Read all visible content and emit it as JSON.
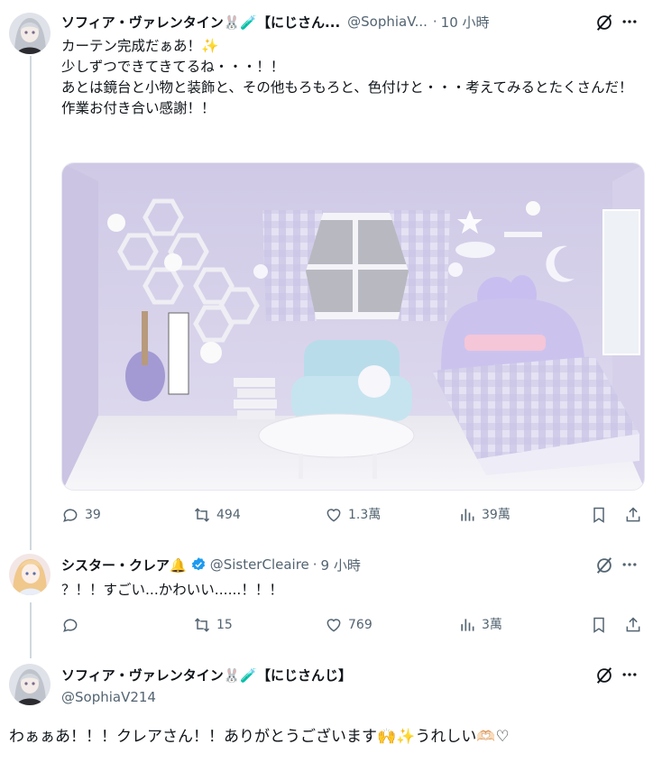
{
  "tweet1": {
    "display_name": "ソフィア・ヴァレンタイン🐰🧪【にじさん...",
    "handle": "@SophiaV...",
    "separator": "·",
    "time": "10 小時",
    "text": "カーテン完成だぁあ！✨\n少しずつできてきてるね・・・！！\nあとは鏡台と小物と装飾と、その他もろもろと、色付けと・・・考えてみるとたくさんだ！\n作業お付き合い感謝！！",
    "stats": {
      "replies": "39",
      "reposts": "494",
      "likes": "1.3萬",
      "views": "39萬"
    }
  },
  "tweet2": {
    "display_name": "シスター・クレア🔔",
    "handle": "@SisterCleaire",
    "separator": "·",
    "time": "9 小時",
    "text": "？！！すごい...かわいい......！！！",
    "stats": {
      "replies": "",
      "reposts": "15",
      "likes": "769",
      "views": "3萬"
    }
  },
  "tweet3": {
    "display_name": "ソフィア・ヴァレンタイン🐰🧪【にじさんじ】",
    "handle": "@SophiaV214",
    "text": "わぁぁあ！！！クレアさん！！ありがとうございます🙌✨うれしい🫶🏻♡"
  },
  "icons": {
    "more": "more-dots-icon",
    "grok": "grok-icon",
    "reply": "reply-icon",
    "repost": "repost-icon",
    "like": "heart-icon",
    "views": "views-chart-icon",
    "bookmark": "bookmark-icon",
    "share": "share-icon",
    "verified": "verified-badge-icon"
  },
  "colors": {
    "muted": "#536471",
    "accent": "#1d9bf0",
    "room_wall": "#dcd6ee",
    "room_floor": "#efeef4"
  }
}
